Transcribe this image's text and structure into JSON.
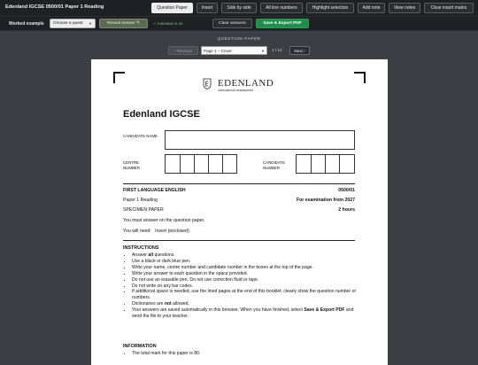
{
  "app": {
    "title": "Edenland IGCSE 0500/01 Paper 1 Reading"
  },
  "toolbar": {
    "buttons": [
      "Question Paper",
      "Insert",
      "Side by side",
      "All line numbers",
      "Highlight selection",
      "Add note",
      "View notes",
      "Clear insert marks"
    ],
    "active": "Question Paper"
  },
  "subbar": {
    "worked_label": "Worked example",
    "quest_select": "Choose a quest",
    "reveal_button": "Reveal answer ✎",
    "autosave": "✓ Autosave is on",
    "clear_button": "Clear answers",
    "export_button": "Save & Export PDF"
  },
  "nav": {
    "section_label": "QUESTION PAPER",
    "prev": "‹ Previous",
    "page_select": "Page 1 – Cover",
    "count": "1 / 14",
    "next": "Next ›"
  },
  "paper": {
    "brand": "EDENLAND",
    "brand_sub": "International Assessment",
    "heading": "Edenland IGCSE",
    "candidate_name_label": "CANDIDATE NAME",
    "centre_number_label": "CENTRE NUMBER",
    "candidate_number_label": "CANDIDATE NUMBER",
    "subject": "FIRST LANGUAGE ENGLISH",
    "code": "0500/01",
    "paper_name": "Paper 1 Reading",
    "exam_from": "For examination from 2027",
    "specimen": "SPECIMEN PAPER",
    "duration": "2 hours",
    "must_answer": "You must answer on the question paper.",
    "need_label": "You will need:",
    "need_value": "Insert (enclosed)",
    "instructions_title": "INSTRUCTIONS",
    "instructions_line1_pre": "Answer ",
    "instructions_line1_bold": "all",
    "instructions_line1_post": " questions.",
    "instructions": [
      "Use a black or dark blue pen.",
      "Write your name, centre number and candidate number in the boxes at the top of the page.",
      "Write your answer to each question in the space provided.",
      "Do not use an erasable pen. Do not use correction fluid or tape.",
      "Do not write on any bar codes.",
      "If additional space is needed, use the lined pages at the end of this booklet; clearly show the question number or numbers."
    ],
    "dict_pre": "Dictionaries are ",
    "dict_bold": "not",
    "dict_post": " allowed.",
    "save_pre": "Your answers are saved automatically in this browser. When you have finished, select ",
    "save_bold1": "Save",
    "save_bold2": "& Export PDF",
    "save_post": " and send the file to your teacher.",
    "information_title": "INFORMATION",
    "info_items": [
      "The total mark for this paper is 80."
    ]
  }
}
